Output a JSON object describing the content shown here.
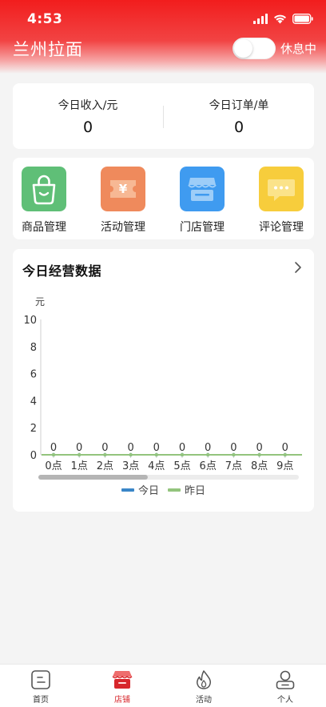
{
  "status_bar": {
    "time": "4:53"
  },
  "header": {
    "shop_name": "兰州拉面",
    "toggle_label": "休息中"
  },
  "stats": [
    {
      "label": "今日收入/元",
      "value": "0"
    },
    {
      "label": "今日订单/单",
      "value": "0"
    }
  ],
  "menu": [
    {
      "label": "商品管理",
      "icon": "shopping-bag-icon",
      "color": "#5fbf77"
    },
    {
      "label": "活动管理",
      "icon": "coupon-icon",
      "color": "#ef8a5c"
    },
    {
      "label": "门店管理",
      "icon": "storefront-icon",
      "color": "#3f9bf0"
    },
    {
      "label": "评论管理",
      "icon": "comment-icon",
      "color": "#f7cd3c"
    }
  ],
  "chart_section": {
    "title": "今日经营数据"
  },
  "chart_data": {
    "type": "line",
    "unit": "元",
    "categories": [
      "0点",
      "1点",
      "2点",
      "3点",
      "4点",
      "5点",
      "6点",
      "7点",
      "8点",
      "9点"
    ],
    "ylim": [
      0,
      10
    ],
    "yticks": [
      0,
      2,
      4,
      6,
      8,
      10
    ],
    "series": [
      {
        "name": "今日",
        "color": "#3a86c8",
        "values": [
          0,
          0,
          0,
          0,
          0,
          0,
          0,
          0,
          0,
          0
        ]
      },
      {
        "name": "昨日",
        "color": "#93c47d",
        "values": [
          0,
          0,
          0,
          0,
          0,
          0,
          0,
          0,
          0,
          0
        ]
      }
    ],
    "grid": false,
    "legend": "bottom-center",
    "scrollbar_fraction": 0.42
  },
  "tabbar": [
    {
      "label": "首页",
      "icon": "home-icon"
    },
    {
      "label": "店铺",
      "icon": "shop-icon",
      "active": true
    },
    {
      "label": "活动",
      "icon": "flame-icon"
    },
    {
      "label": "个人",
      "icon": "user-icon"
    }
  ],
  "colors": {
    "brand_red": "#f21d1d",
    "active_tab": "#d7262b"
  }
}
